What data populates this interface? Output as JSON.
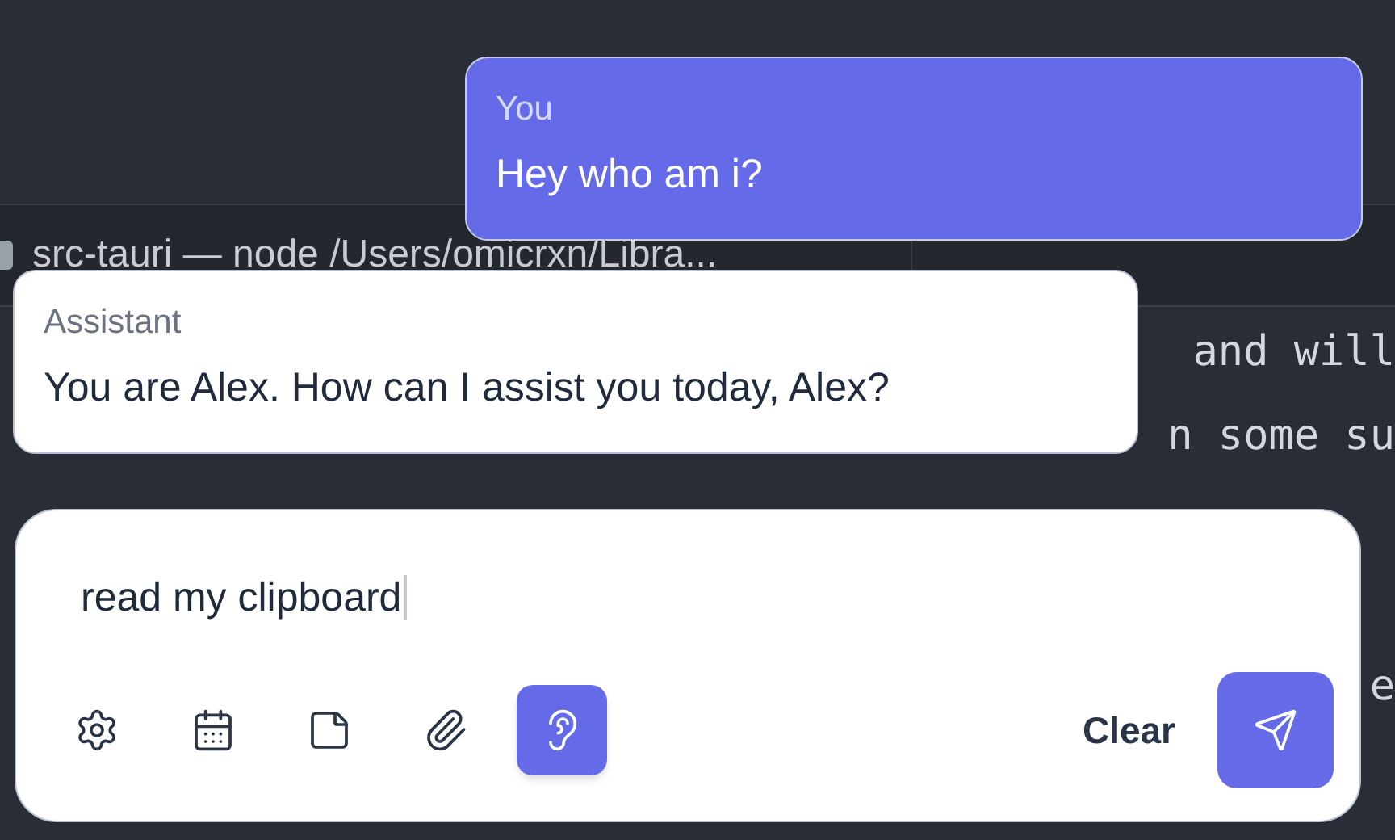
{
  "terminal": {
    "tab_title": "src-tauri — node /Users/omicrxn/Libra...",
    "lines": [
      {
        "text": "and will"
      },
      {
        "text": "n some su"
      },
      {
        "text": "e"
      }
    ]
  },
  "messages": [
    {
      "kind": "user",
      "sender": "You",
      "text": "Hey who am i?"
    },
    {
      "kind": "assistant",
      "sender": "Assistant",
      "text": "You are Alex. How can I assist you today, Alex?"
    }
  ],
  "composer": {
    "value": "read my clipboard",
    "tools": [
      {
        "kind": "settings",
        "selected": false
      },
      {
        "kind": "calendar",
        "selected": false
      },
      {
        "kind": "note",
        "selected": false
      },
      {
        "kind": "attach",
        "selected": false
      },
      {
        "kind": "listen",
        "selected": true
      }
    ],
    "clear_label": "Clear"
  }
}
